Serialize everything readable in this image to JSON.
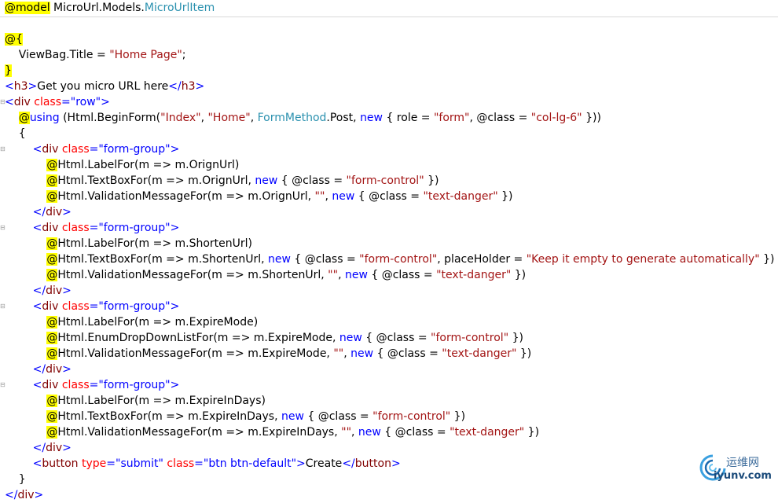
{
  "editor": {
    "lines": [
      [
        {
          "t": "@model",
          "c": "hl"
        },
        {
          "t": " MicroUrl.Models.",
          "c": "plain"
        },
        {
          "t": "MicroUrlItem",
          "c": "type"
        }
      ],
      [],
      [
        {
          "t": "@{",
          "c": "hl"
        }
      ],
      [
        {
          "t": "    ViewBag.Title = ",
          "c": "plain"
        },
        {
          "t": "\"Home Page\"",
          "c": "str"
        },
        {
          "t": ";",
          "c": "plain"
        }
      ],
      [
        {
          "t": "}",
          "c": "hl"
        }
      ],
      [
        {
          "t": "<",
          "c": "blue"
        },
        {
          "t": "h3",
          "c": "tag"
        },
        {
          "t": ">",
          "c": "blue"
        },
        {
          "t": "Get you micro URL here",
          "c": "plain"
        },
        {
          "t": "</",
          "c": "blue"
        },
        {
          "t": "h3",
          "c": "tag"
        },
        {
          "t": ">",
          "c": "blue"
        }
      ],
      [
        {
          "t": "<",
          "c": "blue"
        },
        {
          "t": "div",
          "c": "tag"
        },
        {
          "t": " class",
          "c": "attr"
        },
        {
          "t": "=",
          "c": "blue"
        },
        {
          "t": "\"row\"",
          "c": "blue"
        },
        {
          "t": ">",
          "c": "blue"
        }
      ],
      [
        {
          "t": "    ",
          "c": "plain"
        },
        {
          "t": "@",
          "c": "hl"
        },
        {
          "t": "using",
          "c": "kw"
        },
        {
          "t": " (Html.BeginForm(",
          "c": "plain"
        },
        {
          "t": "\"Index\"",
          "c": "str"
        },
        {
          "t": ", ",
          "c": "plain"
        },
        {
          "t": "\"Home\"",
          "c": "str"
        },
        {
          "t": ", ",
          "c": "plain"
        },
        {
          "t": "FormMethod",
          "c": "type"
        },
        {
          "t": ".Post, ",
          "c": "plain"
        },
        {
          "t": "new",
          "c": "kw"
        },
        {
          "t": " { role = ",
          "c": "plain"
        },
        {
          "t": "\"form\"",
          "c": "str"
        },
        {
          "t": ", @class = ",
          "c": "plain"
        },
        {
          "t": "\"col-lg-6\"",
          "c": "str"
        },
        {
          "t": " }))",
          "c": "plain"
        }
      ],
      [
        {
          "t": "    {",
          "c": "plain"
        }
      ],
      [
        {
          "t": "        ",
          "c": "plain"
        },
        {
          "t": "<",
          "c": "blue"
        },
        {
          "t": "div",
          "c": "tag"
        },
        {
          "t": " class",
          "c": "attr"
        },
        {
          "t": "=",
          "c": "blue"
        },
        {
          "t": "\"form-group\"",
          "c": "blue"
        },
        {
          "t": ">",
          "c": "blue"
        }
      ],
      [
        {
          "t": "            ",
          "c": "plain"
        },
        {
          "t": "@",
          "c": "hl"
        },
        {
          "t": "Html.LabelFor(m => m.OrignUrl)",
          "c": "plain"
        }
      ],
      [
        {
          "t": "            ",
          "c": "plain"
        },
        {
          "t": "@",
          "c": "hl"
        },
        {
          "t": "Html.TextBoxFor(m => m.OrignUrl, ",
          "c": "plain"
        },
        {
          "t": "new",
          "c": "kw"
        },
        {
          "t": " { @class = ",
          "c": "plain"
        },
        {
          "t": "\"form-control\"",
          "c": "str"
        },
        {
          "t": " })",
          "c": "plain"
        }
      ],
      [
        {
          "t": "            ",
          "c": "plain"
        },
        {
          "t": "@",
          "c": "hl"
        },
        {
          "t": "Html.ValidationMessageFor(m => m.OrignUrl, ",
          "c": "plain"
        },
        {
          "t": "\"\"",
          "c": "str"
        },
        {
          "t": ", ",
          "c": "plain"
        },
        {
          "t": "new",
          "c": "kw"
        },
        {
          "t": " { @class = ",
          "c": "plain"
        },
        {
          "t": "\"text-danger\"",
          "c": "str"
        },
        {
          "t": " })",
          "c": "plain"
        }
      ],
      [
        {
          "t": "        ",
          "c": "plain"
        },
        {
          "t": "</",
          "c": "blue"
        },
        {
          "t": "div",
          "c": "tag"
        },
        {
          "t": ">",
          "c": "blue"
        }
      ],
      [
        {
          "t": "        ",
          "c": "plain"
        },
        {
          "t": "<",
          "c": "blue"
        },
        {
          "t": "div",
          "c": "tag"
        },
        {
          "t": " class",
          "c": "attr"
        },
        {
          "t": "=",
          "c": "blue"
        },
        {
          "t": "\"form-group\"",
          "c": "blue"
        },
        {
          "t": ">",
          "c": "blue"
        }
      ],
      [
        {
          "t": "            ",
          "c": "plain"
        },
        {
          "t": "@",
          "c": "hl"
        },
        {
          "t": "Html.LabelFor(m => m.ShortenUrl)",
          "c": "plain"
        }
      ],
      [
        {
          "t": "            ",
          "c": "plain"
        },
        {
          "t": "@",
          "c": "hl"
        },
        {
          "t": "Html.TextBoxFor(m => m.ShortenUrl, ",
          "c": "plain"
        },
        {
          "t": "new",
          "c": "kw"
        },
        {
          "t": " { @class = ",
          "c": "plain"
        },
        {
          "t": "\"form-control\"",
          "c": "str"
        },
        {
          "t": ", placeHolder = ",
          "c": "plain"
        },
        {
          "t": "\"Keep it empty to generate automatically\"",
          "c": "str"
        },
        {
          "t": " })",
          "c": "plain"
        }
      ],
      [
        {
          "t": "            ",
          "c": "plain"
        },
        {
          "t": "@",
          "c": "hl"
        },
        {
          "t": "Html.ValidationMessageFor(m => m.ShortenUrl, ",
          "c": "plain"
        },
        {
          "t": "\"\"",
          "c": "str"
        },
        {
          "t": ", ",
          "c": "plain"
        },
        {
          "t": "new",
          "c": "kw"
        },
        {
          "t": " { @class = ",
          "c": "plain"
        },
        {
          "t": "\"text-danger\"",
          "c": "str"
        },
        {
          "t": " })",
          "c": "plain"
        }
      ],
      [
        {
          "t": "        ",
          "c": "plain"
        },
        {
          "t": "</",
          "c": "blue"
        },
        {
          "t": "div",
          "c": "tag"
        },
        {
          "t": ">",
          "c": "blue"
        }
      ],
      [
        {
          "t": "        ",
          "c": "plain"
        },
        {
          "t": "<",
          "c": "blue"
        },
        {
          "t": "div",
          "c": "tag"
        },
        {
          "t": " class",
          "c": "attr"
        },
        {
          "t": "=",
          "c": "blue"
        },
        {
          "t": "\"form-group\"",
          "c": "blue"
        },
        {
          "t": ">",
          "c": "blue"
        }
      ],
      [
        {
          "t": "            ",
          "c": "plain"
        },
        {
          "t": "@",
          "c": "hl"
        },
        {
          "t": "Html.LabelFor(m => m.ExpireMode)",
          "c": "plain"
        }
      ],
      [
        {
          "t": "            ",
          "c": "plain"
        },
        {
          "t": "@",
          "c": "hl"
        },
        {
          "t": "Html.EnumDropDownListFor(m => m.ExpireMode, ",
          "c": "plain"
        },
        {
          "t": "new",
          "c": "kw"
        },
        {
          "t": " { @class = ",
          "c": "plain"
        },
        {
          "t": "\"form-control\"",
          "c": "str"
        },
        {
          "t": " })",
          "c": "plain"
        }
      ],
      [
        {
          "t": "            ",
          "c": "plain"
        },
        {
          "t": "@",
          "c": "hl"
        },
        {
          "t": "Html.ValidationMessageFor(m => m.ExpireMode, ",
          "c": "plain"
        },
        {
          "t": "\"\"",
          "c": "str"
        },
        {
          "t": ", ",
          "c": "plain"
        },
        {
          "t": "new",
          "c": "kw"
        },
        {
          "t": " { @class = ",
          "c": "plain"
        },
        {
          "t": "\"text-danger\"",
          "c": "str"
        },
        {
          "t": " })",
          "c": "plain"
        }
      ],
      [
        {
          "t": "        ",
          "c": "plain"
        },
        {
          "t": "</",
          "c": "blue"
        },
        {
          "t": "div",
          "c": "tag"
        },
        {
          "t": ">",
          "c": "blue"
        }
      ],
      [
        {
          "t": "        ",
          "c": "plain"
        },
        {
          "t": "<",
          "c": "blue"
        },
        {
          "t": "div",
          "c": "tag"
        },
        {
          "t": " class",
          "c": "attr"
        },
        {
          "t": "=",
          "c": "blue"
        },
        {
          "t": "\"form-group\"",
          "c": "blue"
        },
        {
          "t": ">",
          "c": "blue"
        }
      ],
      [
        {
          "t": "            ",
          "c": "plain"
        },
        {
          "t": "@",
          "c": "hl"
        },
        {
          "t": "Html.LabelFor(m => m.ExpireInDays)",
          "c": "plain"
        }
      ],
      [
        {
          "t": "            ",
          "c": "plain"
        },
        {
          "t": "@",
          "c": "hl"
        },
        {
          "t": "Html.TextBoxFor(m => m.ExpireInDays, ",
          "c": "plain"
        },
        {
          "t": "new",
          "c": "kw"
        },
        {
          "t": " { @class = ",
          "c": "plain"
        },
        {
          "t": "\"form-control\"",
          "c": "str"
        },
        {
          "t": " })",
          "c": "plain"
        }
      ],
      [
        {
          "t": "            ",
          "c": "plain"
        },
        {
          "t": "@",
          "c": "hl"
        },
        {
          "t": "Html.ValidationMessageFor(m => m.ExpireInDays, ",
          "c": "plain"
        },
        {
          "t": "\"\"",
          "c": "str"
        },
        {
          "t": ", ",
          "c": "plain"
        },
        {
          "t": "new",
          "c": "kw"
        },
        {
          "t": " { @class = ",
          "c": "plain"
        },
        {
          "t": "\"text-danger\"",
          "c": "str"
        },
        {
          "t": " })",
          "c": "plain"
        }
      ],
      [
        {
          "t": "        ",
          "c": "plain"
        },
        {
          "t": "</",
          "c": "blue"
        },
        {
          "t": "div",
          "c": "tag"
        },
        {
          "t": ">",
          "c": "blue"
        }
      ],
      [
        {
          "t": "        ",
          "c": "plain"
        },
        {
          "t": "<",
          "c": "blue"
        },
        {
          "t": "button",
          "c": "tag"
        },
        {
          "t": " type",
          "c": "attr"
        },
        {
          "t": "=",
          "c": "blue"
        },
        {
          "t": "\"submit\"",
          "c": "blue"
        },
        {
          "t": " class",
          "c": "attr"
        },
        {
          "t": "=",
          "c": "blue"
        },
        {
          "t": "\"btn btn-default\"",
          "c": "blue"
        },
        {
          "t": ">",
          "c": "blue"
        },
        {
          "t": "Create",
          "c": "plain"
        },
        {
          "t": "</",
          "c": "blue"
        },
        {
          "t": "button",
          "c": "tag"
        },
        {
          "t": ">",
          "c": "blue"
        }
      ],
      [
        {
          "t": "    }",
          "c": "plain"
        }
      ],
      [
        {
          "t": "</",
          "c": "blue"
        },
        {
          "t": "div",
          "c": "tag"
        },
        {
          "t": ">",
          "c": "blue"
        }
      ]
    ]
  },
  "watermark": {
    "cn": "运维网",
    "domain": "iyunv.com"
  }
}
